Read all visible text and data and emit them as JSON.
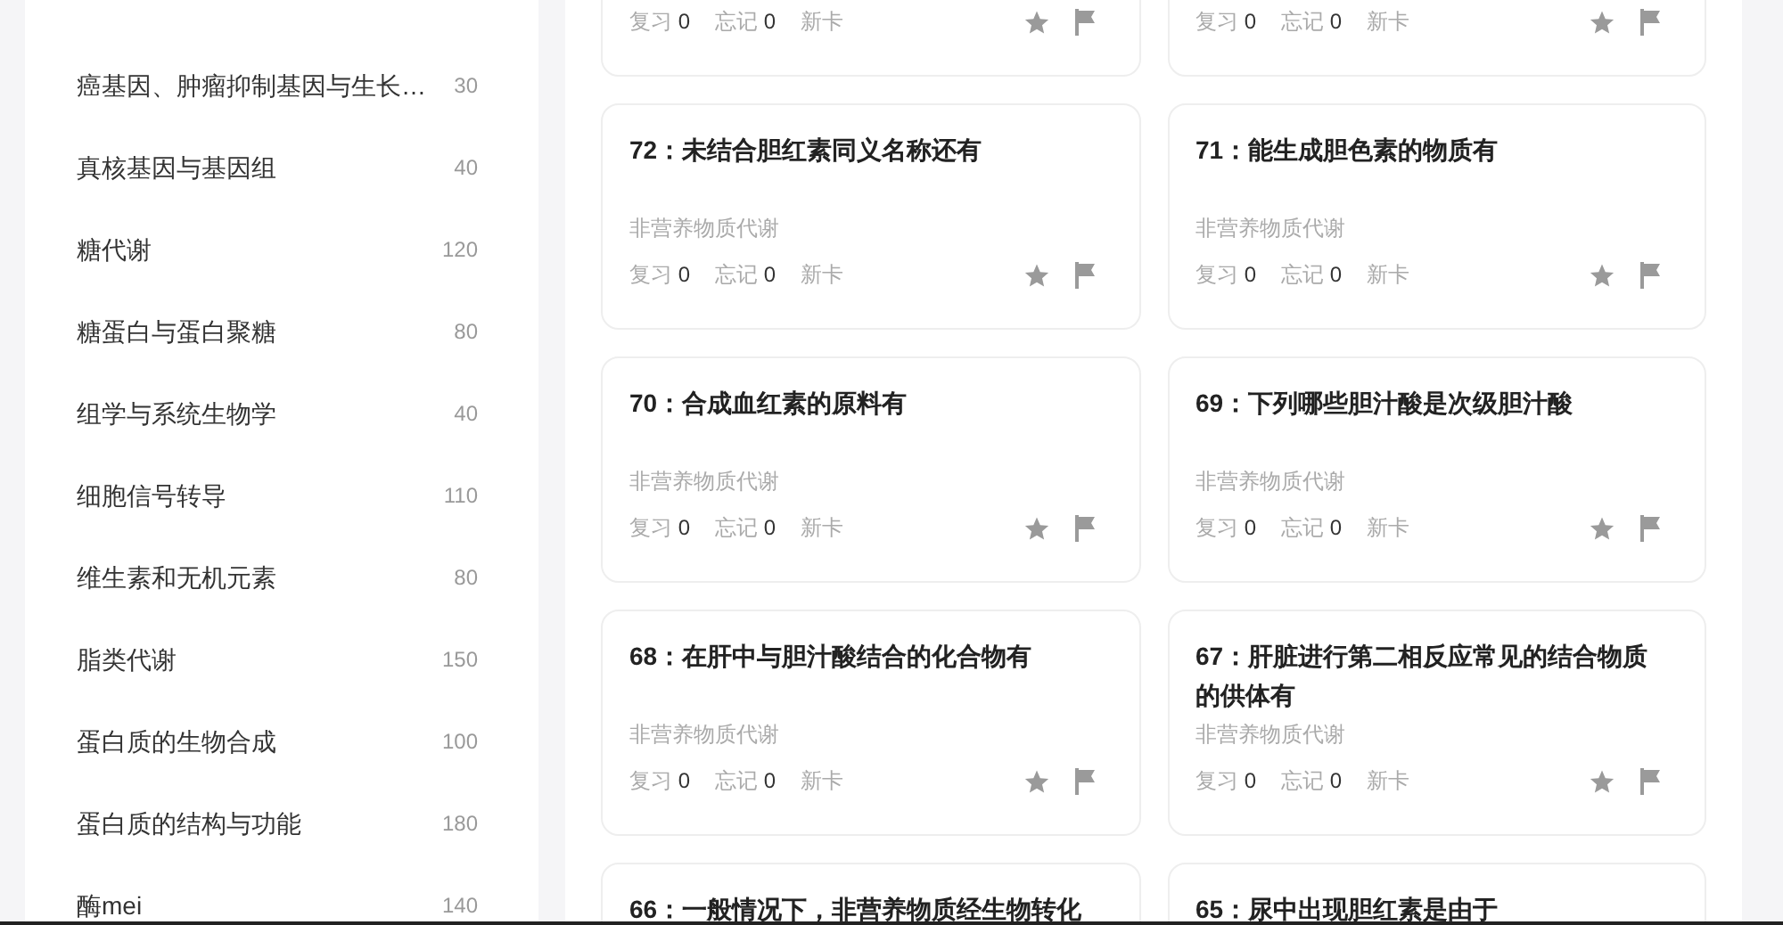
{
  "sidebar": {
    "items": [
      {
        "label": "癌基因、肿瘤抑制基因与生长…",
        "count": "30"
      },
      {
        "label": "真核基因与基因组",
        "count": "40"
      },
      {
        "label": "糖代谢",
        "count": "120"
      },
      {
        "label": "糖蛋白与蛋白聚糖",
        "count": "80"
      },
      {
        "label": "组学与系统生物学",
        "count": "40"
      },
      {
        "label": "细胞信号转导",
        "count": "110"
      },
      {
        "label": "维生素和无机元素",
        "count": "80"
      },
      {
        "label": "脂类代谢",
        "count": "150"
      },
      {
        "label": "蛋白质的生物合成",
        "count": "100"
      },
      {
        "label": "蛋白质的结构与功能",
        "count": "180"
      },
      {
        "label": "酶mei",
        "count": "140"
      }
    ]
  },
  "cards": [
    {
      "stats": {
        "review_label": "复习",
        "review_count": "0",
        "forget_label": "忘记",
        "forget_count": "0",
        "new_label": "新卡"
      }
    },
    {
      "stats": {
        "review_label": "复习",
        "review_count": "0",
        "forget_label": "忘记",
        "forget_count": "0",
        "new_label": "新卡"
      }
    },
    {
      "title": "72：未结合胆红素同义名称还有",
      "tag": "非营养物质代谢",
      "stats": {
        "review_label": "复习",
        "review_count": "0",
        "forget_label": "忘记",
        "forget_count": "0",
        "new_label": "新卡"
      }
    },
    {
      "title": "71：能生成胆色素的物质有",
      "tag": "非营养物质代谢",
      "stats": {
        "review_label": "复习",
        "review_count": "0",
        "forget_label": "忘记",
        "forget_count": "0",
        "new_label": "新卡"
      }
    },
    {
      "title": "70：合成血红素的原料有",
      "tag": "非营养物质代谢",
      "stats": {
        "review_label": "复习",
        "review_count": "0",
        "forget_label": "忘记",
        "forget_count": "0",
        "new_label": "新卡"
      }
    },
    {
      "title": "69：下列哪些胆汁酸是次级胆汁酸",
      "tag": "非营养物质代谢",
      "stats": {
        "review_label": "复习",
        "review_count": "0",
        "forget_label": "忘记",
        "forget_count": "0",
        "new_label": "新卡"
      }
    },
    {
      "title": "68：在肝中与胆汁酸结合的化合物有",
      "tag": "非营养物质代谢",
      "stats": {
        "review_label": "复习",
        "review_count": "0",
        "forget_label": "忘记",
        "forget_count": "0",
        "new_label": "新卡"
      }
    },
    {
      "title": "67：肝脏进行第二相反应常见的结合物质的供体有",
      "tag": "非营养物质代谢",
      "stats": {
        "review_label": "复习",
        "review_count": "0",
        "forget_label": "忘记",
        "forget_count": "0",
        "new_label": "新卡"
      }
    },
    {
      "title": "66：一般情况下，非营养物质经生物转化"
    },
    {
      "title": "65：尿中出现胆红素是由于"
    }
  ]
}
